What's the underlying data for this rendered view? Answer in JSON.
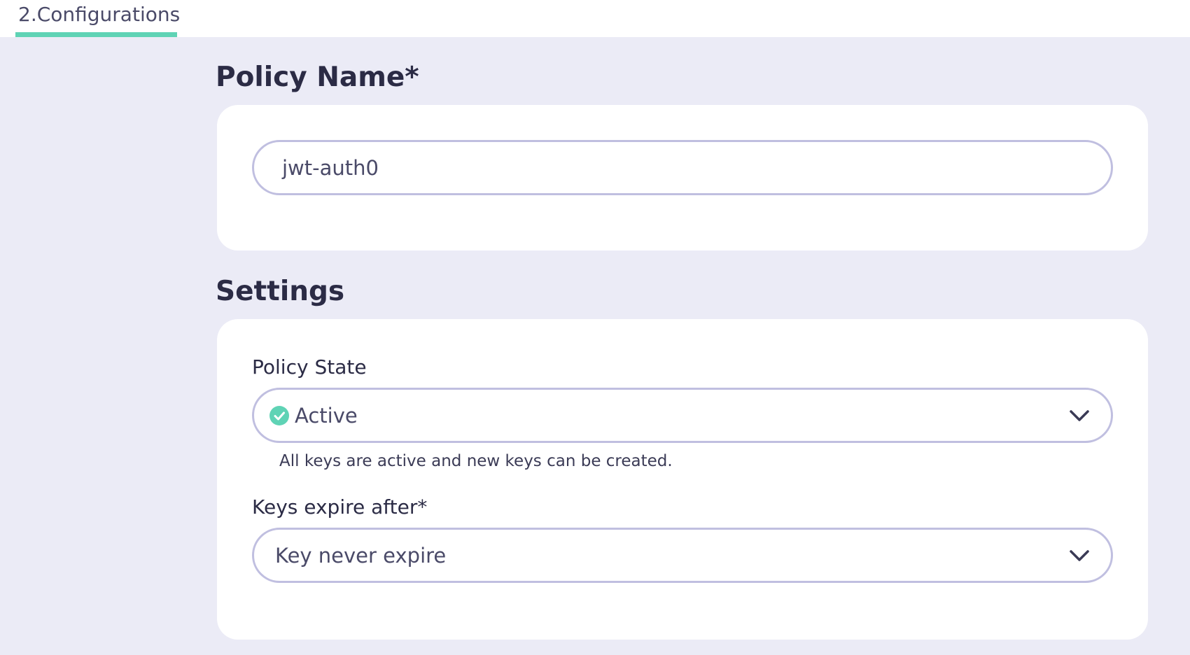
{
  "header": {
    "tab_label": "2.Configurations",
    "tab_accent": "#5fd3b5"
  },
  "policy_name_section": {
    "title": "Policy Name*",
    "value": "jwt-auth0"
  },
  "settings_section": {
    "title": "Settings",
    "policy_state": {
      "label": "Policy State",
      "selected": "Active",
      "status_icon": "check-circle-icon",
      "status_color": "#5fd3b5",
      "helper": "All keys are active and new keys can be created."
    },
    "keys_expire": {
      "label": "Keys expire after*",
      "selected": "Key never expire"
    }
  }
}
